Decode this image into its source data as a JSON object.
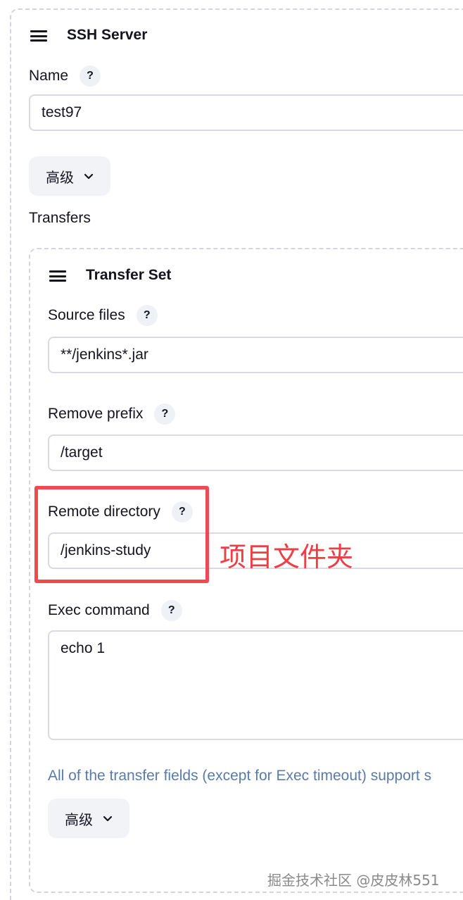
{
  "ssh_server": {
    "section_title": "SSH Server",
    "name_label": "Name",
    "name_value": "test97",
    "advanced_label": "高级",
    "transfers_label": "Transfers"
  },
  "transfer_set": {
    "section_title": "Transfer Set",
    "source_files_label": "Source files",
    "source_files_value": "**/jenkins*.jar",
    "remove_prefix_label": "Remove prefix",
    "remove_prefix_value": "/target",
    "remote_directory_label": "Remote directory",
    "remote_directory_value": "/jenkins-study",
    "exec_command_label": "Exec command",
    "exec_command_value": "echo 1",
    "note": "All of the transfer fields (except for Exec timeout) support s",
    "advanced_label": "高级"
  },
  "help_icon_text": "?",
  "annotation": {
    "text": "项目文件夹",
    "color": "#ee3d45"
  },
  "watermark": "掘金技术社区 @皮皮林551",
  "icons": {
    "drag_handle": "hamburger-drag-icon",
    "help": "question-mark-icon",
    "chevron": "chevron-down-icon"
  }
}
